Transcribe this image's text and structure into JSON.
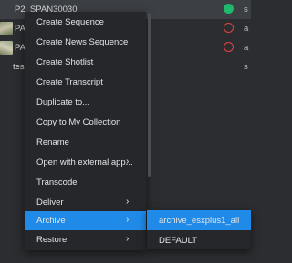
{
  "list": {
    "rows": [
      {
        "name": "P2_SPAN30030",
        "status": "green",
        "trail": "s"
      },
      {
        "name": "PA",
        "status": "red",
        "trail": "a"
      },
      {
        "name": "PA",
        "status": "red",
        "trail": "a"
      },
      {
        "name": "tes",
        "status": "",
        "trail": "s"
      }
    ]
  },
  "context_menu": {
    "items": [
      {
        "label": "Create Sequence"
      },
      {
        "label": "Create News Sequence"
      },
      {
        "label": "Create Shotlist"
      },
      {
        "label": "Create Transcript"
      },
      {
        "label": "Duplicate to..."
      },
      {
        "label": "Copy to My Collection"
      },
      {
        "label": "Rename"
      },
      {
        "label": "Open with external app..."
      },
      {
        "label": "Transcode"
      },
      {
        "label": "Deliver"
      },
      {
        "label": "Archive"
      },
      {
        "label": "Restore"
      }
    ],
    "chevron": "›"
  },
  "submenu": {
    "items": [
      {
        "label": "archive_esxplus1_all"
      },
      {
        "label": "DEFAULT"
      }
    ]
  },
  "colors": {
    "accent": "#1f8ae8",
    "status_green": "#1fb86c",
    "status_red": "#e2453f",
    "menu_bg": "#25272a",
    "page_bg": "#2b2d30"
  },
  "icons": {
    "chevron": "chevron-right-icon",
    "status_online": "status-online-icon",
    "status_offline": "status-offline-icon"
  }
}
